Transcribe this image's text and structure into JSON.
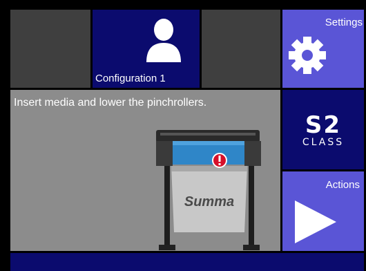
{
  "tiles": {
    "configuration": {
      "label": "Configuration 1",
      "icon": "user-icon"
    },
    "settings": {
      "label": "Settings",
      "icon": "gear-icon"
    },
    "actions": {
      "label": "Actions",
      "icon": "play-icon"
    },
    "logo": {
      "name": "s2-class-logo",
      "line1": "S2",
      "line2": "CLASS"
    }
  },
  "message": {
    "text": "Insert media and lower the pinchrollers.",
    "illustration": "cutting-plotter-image",
    "brand": "Summa",
    "alert_icon": "exclamation-icon"
  },
  "colors": {
    "dark_blue": "#0b0b6e",
    "accent_purple": "#5a55d6",
    "blank_tile": "#3f3f3f",
    "message_bg": "#8c8c8c",
    "alert_red": "#d6102a",
    "plotter_blue": "#2f86c8"
  }
}
